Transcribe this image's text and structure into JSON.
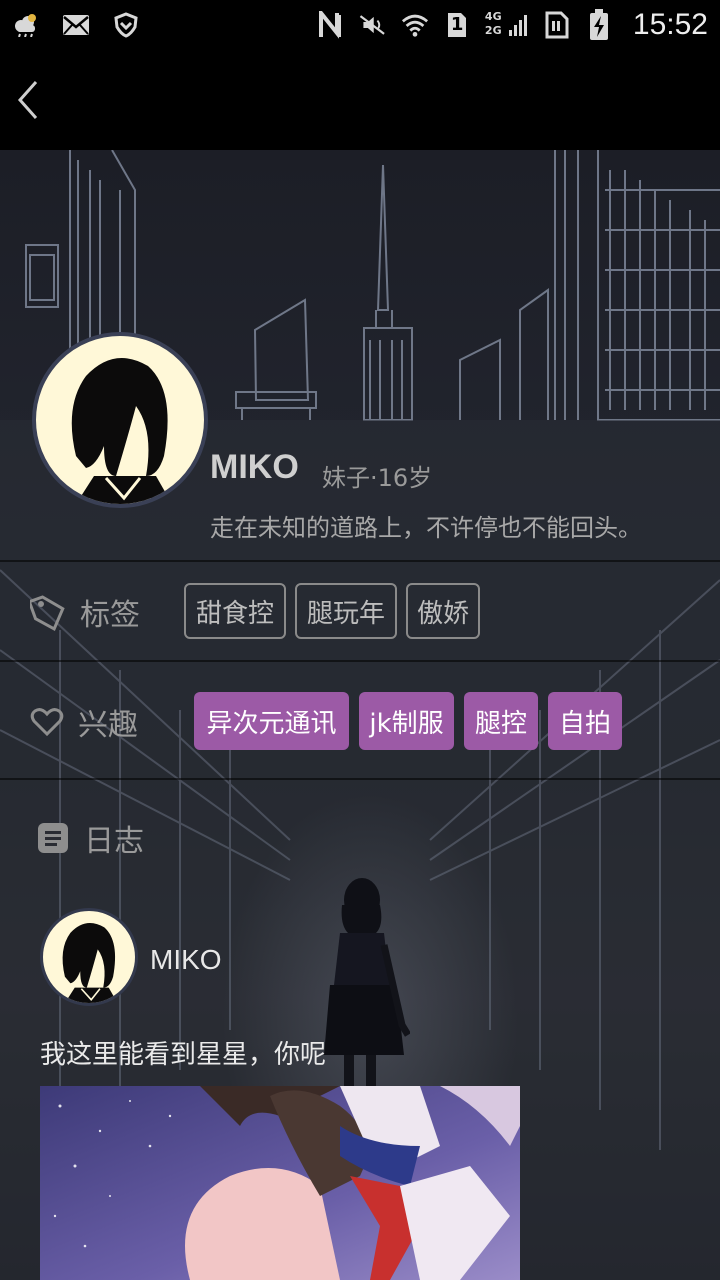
{
  "status_bar": {
    "time": "15:52",
    "left_icons": [
      "weather-cloud-icon",
      "mail-icon",
      "shield-icon"
    ],
    "right_icons": [
      "nfc-icon",
      "mute-icon",
      "wifi-icon",
      "sim-1-icon",
      "signal-4g-2g-icon",
      "sim-card-icon",
      "battery-charging-icon"
    ],
    "network_label_top": "4G",
    "network_label_bottom": "2G",
    "sim_label": "1"
  },
  "nav": {
    "back_icon": "chevron-left-icon"
  },
  "profile": {
    "name": "MIKO",
    "meta": "妹子·16岁",
    "bio": "走在未知的道路上，不许停也不能回头。"
  },
  "tags_section": {
    "label": "标签",
    "icon": "tag-icon",
    "items": [
      "甜食控",
      "腿玩年",
      "傲娇"
    ]
  },
  "interests_section": {
    "label": "兴趣",
    "icon": "heart-icon",
    "items": [
      "异次元通讯",
      "jk制服",
      "腿控",
      "自拍"
    ]
  },
  "diary_section": {
    "label": "日志",
    "icon": "document-icon"
  },
  "post": {
    "author": "MIKO",
    "text": "我这里能看到星星，你呢"
  },
  "colors": {
    "interest_chip": "#9c5aa6",
    "background": "#23262e",
    "avatar_bg": "#fff8d8"
  }
}
